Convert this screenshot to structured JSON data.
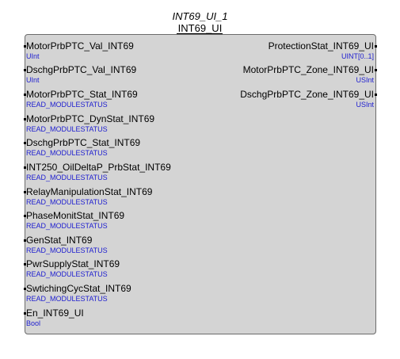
{
  "block": {
    "instance_name": "INT69_UI_1",
    "type_name": "INT69_UI"
  },
  "inputs": [
    {
      "name": "MotorPrbPTC_Val_INT69",
      "type": "UInt"
    },
    {
      "name": "DschgPrbPTC_Val_INT69",
      "type": "UInt"
    },
    {
      "name": "MotorPrbPTC_Stat_INT69",
      "type": "READ_MODULESTATUS"
    },
    {
      "name": "MotorPrbPTC_DynStat_INT69",
      "type": "READ_MODULESTATUS"
    },
    {
      "name": "DschgPrbPTC_Stat_INT69",
      "type": "READ_MODULESTATUS"
    },
    {
      "name": "INT250_OilDeltaP_PrbStat_INT69",
      "type": "READ_MODULESTATUS"
    },
    {
      "name": "RelayManipulationStat_INT69",
      "type": "READ_MODULESTATUS"
    },
    {
      "name": "PhaseMonitStat_INT69",
      "type": "READ_MODULESTATUS"
    },
    {
      "name": "GenStat_INT69",
      "type": "READ_MODULESTATUS"
    },
    {
      "name": "PwrSupplyStat_INT69",
      "type": "READ_MODULESTATUS"
    },
    {
      "name": "SwtichingCycStat_INT69",
      "type": "READ_MODULESTATUS"
    },
    {
      "name": "En_INT69_UI",
      "type": "Bool"
    }
  ],
  "outputs": [
    {
      "name": "ProtectionStat_INT69_UI",
      "type": "UINT[0..1]"
    },
    {
      "name": "MotorPrbPTC_Zone_INT69_UI",
      "type": "USInt"
    },
    {
      "name": "DschgPrbPTC_Zone_INT69_UI",
      "type": "USInt"
    }
  ]
}
